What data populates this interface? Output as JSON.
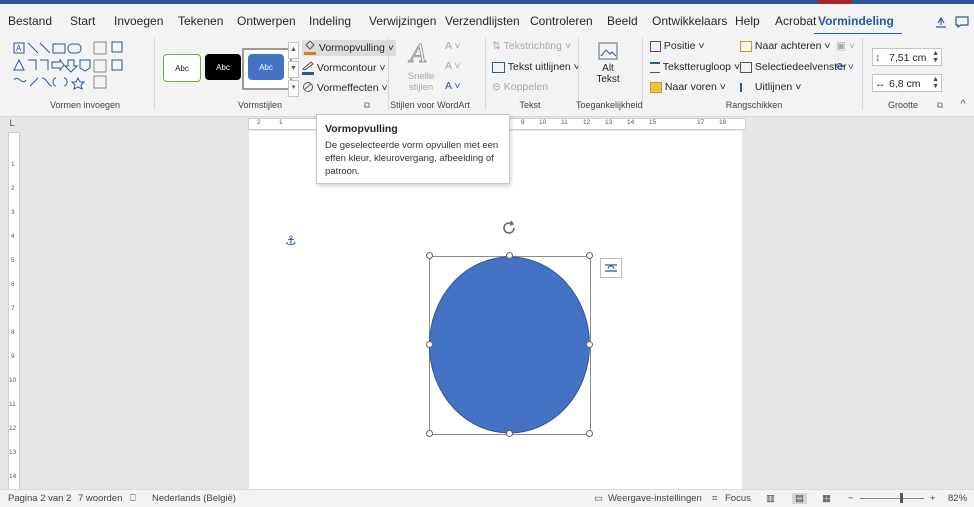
{
  "tabs": [
    {
      "label": "Bestand",
      "active": false
    },
    {
      "label": "Start",
      "active": false
    },
    {
      "label": "Invoegen",
      "active": false
    },
    {
      "label": "Tekenen",
      "active": false
    },
    {
      "label": "Ontwerpen",
      "active": false
    },
    {
      "label": "Indeling",
      "active": false
    },
    {
      "label": "Verwijzingen",
      "active": false
    },
    {
      "label": "Verzendlijsten",
      "active": false
    },
    {
      "label": "Controleren",
      "active": false
    },
    {
      "label": "Beeld",
      "active": false
    },
    {
      "label": "Ontwikkelaars",
      "active": false
    },
    {
      "label": "Help",
      "active": false
    },
    {
      "label": "Acrobat",
      "active": false
    },
    {
      "label": "Vormindeling",
      "active": true
    }
  ],
  "groups": {
    "insert_shapes": "Vormen invoegen",
    "shape_styles": "Vormstijlen",
    "wordart_styles": "Stijlen voor WordArt",
    "text": "Tekst",
    "accessibility": "Toegankelijkheid",
    "arrange": "Rangschikken",
    "size": "Grootte"
  },
  "style_swatches": [
    "Abc",
    "Abc",
    "Abc"
  ],
  "shape_style_commands": {
    "fill": "Vormopvulling",
    "outline": "Vormcontour",
    "effects": "Vormeffecten"
  },
  "quick_styles": {
    "line1": "Snelle",
    "line2": "stijlen"
  },
  "text_commands": {
    "direction": "Tekstrichting",
    "align": "Tekst uitlijnen",
    "link": "Koppelen"
  },
  "alt_text": {
    "line1": "Alt",
    "line2": "Tekst"
  },
  "arrange_commands": {
    "position": "Positie",
    "wrap": "Tekstterugloop",
    "forward": "Naar voren",
    "backward": "Naar achteren",
    "selection_pane": "Selectiedeelvenster",
    "align": "Uitlijnen"
  },
  "size": {
    "height": "7,51 cm",
    "width": "6,8 cm"
  },
  "tooltip": {
    "title": "Vormopvulling",
    "body": "De geselecteerde vorm opvullen met een effen kleur, kleurovergang, afbeelding of patroon."
  },
  "ruler_top_numbers": [
    "2",
    "1",
    "9",
    "10",
    "11",
    "12",
    "13",
    "14",
    "15",
    "17",
    "18"
  ],
  "ruler_left_numbers": [
    "1",
    "2",
    "3",
    "4",
    "5",
    "6",
    "7",
    "8",
    "9",
    "10",
    "11",
    "12",
    "13",
    "14"
  ],
  "status": {
    "page": "Pagina 2 van 2",
    "words": "7 woorden",
    "language": "Nederlands (België)",
    "display_settings": "Weergave-instellingen",
    "focus": "Focus",
    "zoom": "82%"
  },
  "colors": {
    "accent": "#2b579a",
    "shape_fill": "#4472c4",
    "shape_outline": "#2f528f",
    "swatch_black": "#000000"
  }
}
